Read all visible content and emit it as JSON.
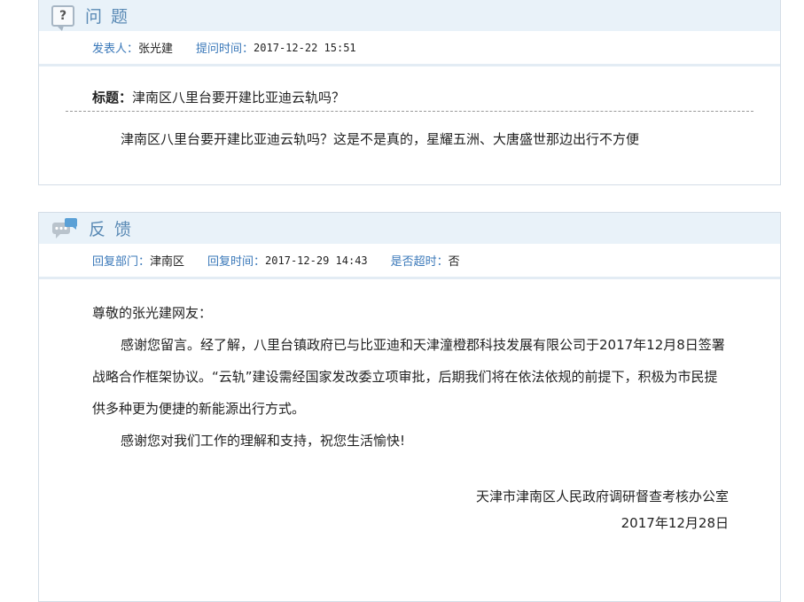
{
  "question": {
    "header_title": "问 题",
    "author_label": "发表人：",
    "author_value": "张光建",
    "time_label": "提问时间：",
    "time_value": "2017-12-22 15:51",
    "subject_label": "标题：",
    "subject_value": "津南区八里台要开建比亚迪云轨吗？",
    "body": "津南区八里台要开建比亚迪云轨吗？这是不是真的，星耀五洲、大唐盛世那边出行不方便"
  },
  "feedback": {
    "header_title": "反 馈",
    "dept_label": "回复部门：",
    "dept_value": "津南区",
    "time_label": "回复时间：",
    "time_value": "2017-12-29 14:43",
    "overdue_label": "是否超时：",
    "overdue_value": "否",
    "greeting": "尊敬的张光建网友：",
    "para1": "感谢您留言。经了解，八里台镇政府已与比亚迪和天津潼橙郡科技发展有限公司于2017年12月8日签署战略合作框架协议。“云轨”建设需经国家发改委立项审批，后期我们将在依法依规的前提下，积极为市民提供多种更为便捷的新能源出行方式。",
    "para2": "感谢您对我们工作的理解和支持，祝您生活愉快!",
    "signature_org": "天津市津南区人民政府调研督查考核办公室",
    "signature_date": "2017年12月28日"
  },
  "icons": {
    "question_icon": "question-bubble-icon",
    "feedback_icon": "chat-bubbles-icon"
  },
  "colors": {
    "accent": "#3a78b9",
    "header_bg": "#e9f2f9",
    "header_title": "#5a8ab5"
  }
}
